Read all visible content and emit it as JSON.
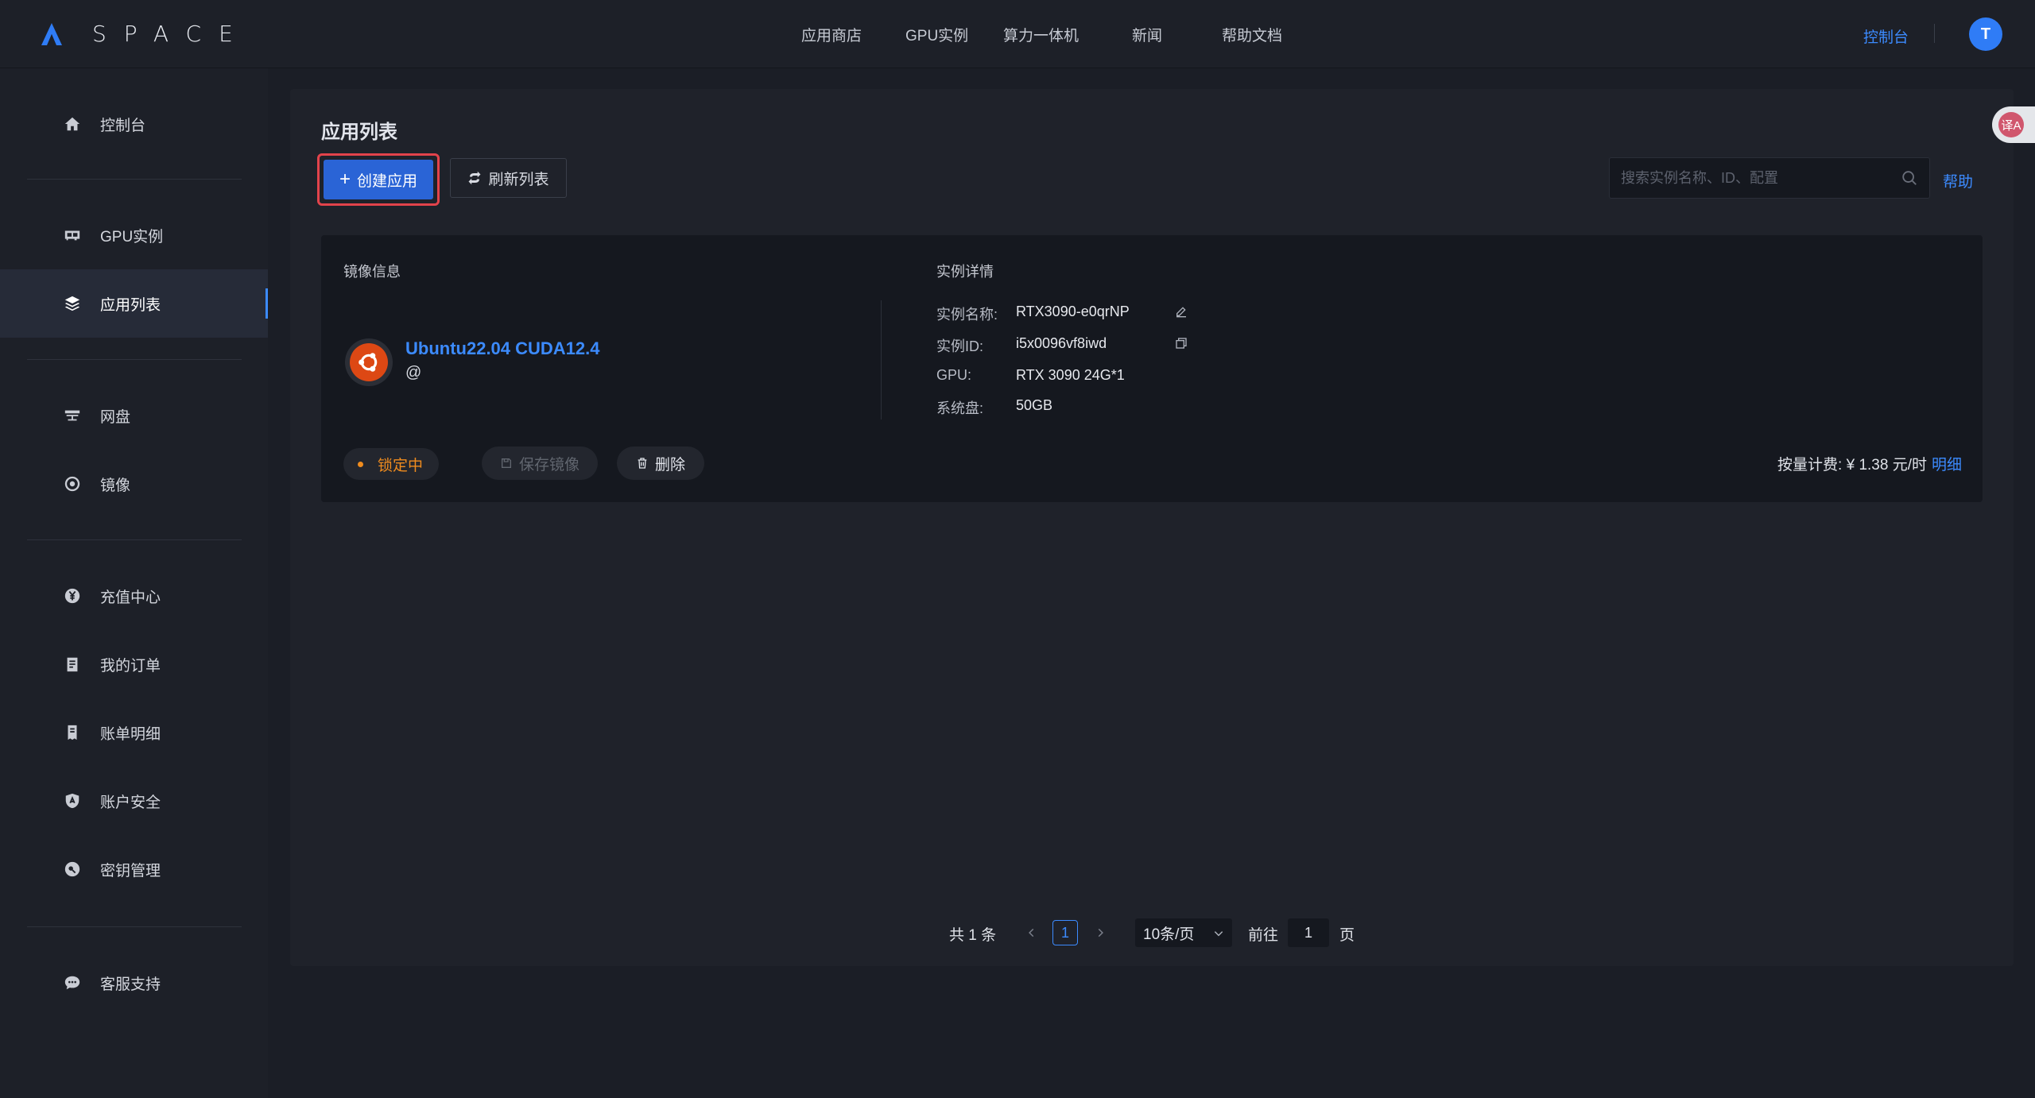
{
  "brand": {
    "name": "SPACE"
  },
  "topnav": {
    "items": [
      "应用商店",
      "GPU实例",
      "算力一体机",
      "新闻",
      "帮助文档"
    ],
    "console": "控制台",
    "avatar": "T"
  },
  "sidebar": {
    "items": [
      {
        "label": "控制台",
        "icon": "home-icon"
      },
      {
        "label": "GPU实例",
        "icon": "gpu-card-icon"
      },
      {
        "label": "应用列表",
        "icon": "layers-icon",
        "active": true
      },
      {
        "label": "网盘",
        "icon": "cloud-drive-icon"
      },
      {
        "label": "镜像",
        "icon": "disc-icon"
      },
      {
        "label": "充值中心",
        "icon": "yen-coin-icon"
      },
      {
        "label": "我的订单",
        "icon": "clipboard-icon"
      },
      {
        "label": "账单明细",
        "icon": "bill-icon"
      },
      {
        "label": "账户安全",
        "icon": "shield-icon"
      },
      {
        "label": "密钥管理",
        "icon": "key-icon"
      },
      {
        "label": "客服支持",
        "icon": "chat-bubble-icon"
      }
    ]
  },
  "page": {
    "title": "应用列表",
    "create_button": "创建应用",
    "refresh_button": "刷新列表",
    "search_placeholder": "搜索实例名称、ID、配置",
    "help": "帮助",
    "translate_icon_text": "译A"
  },
  "card": {
    "image_section_label": "镜像信息",
    "detail_section_label": "实例详情",
    "image_name": "Ubuntu22.04 CUDA12.4",
    "image_sub": "@",
    "details": [
      {
        "key": "实例名称:",
        "value": "RTX3090-e0qrNP"
      },
      {
        "key": "实例ID:",
        "value": "i5x0096vf8iwd"
      },
      {
        "key": "GPU:",
        "value": "RTX 3090 24G*1"
      },
      {
        "key": "系统盘:",
        "value": "50GB"
      }
    ],
    "status": "锁定中",
    "save_image_button": "保存镜像",
    "delete_button": "删除",
    "billing_label": "按量计费:",
    "billing_price": "¥ 1.38 元/时",
    "billing_detail_link": "明细"
  },
  "pagination": {
    "total": "共 1 条",
    "current_page": "1",
    "page_size": "10条/页",
    "goto_label": "前往",
    "goto_value": "1",
    "page_suffix": "页"
  },
  "colors": {
    "accent": "#3c8bff",
    "primary_button": "#2a64d6",
    "highlight_border": "#e2434b",
    "status_locked": "#f08c1e",
    "ubuntu_orange": "#dd4814"
  }
}
